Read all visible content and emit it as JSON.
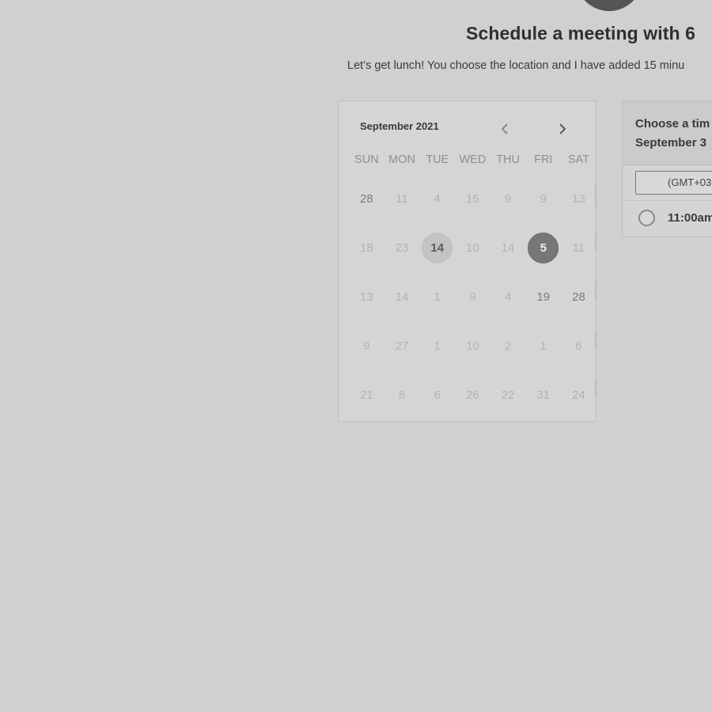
{
  "header": {
    "title": "Schedule a meeting with 6",
    "description": "Let’s get lunch! You choose the location and I have added 15 minu"
  },
  "calendar": {
    "month_label": "September 2021",
    "prev_icon": "chevron-left-icon",
    "next_icon": "chevron-right-icon",
    "weekdays": [
      "SUN",
      "MON",
      "TUE",
      "WED",
      "THU",
      "FRI",
      "SAT"
    ],
    "weeks": [
      [
        "28",
        "11",
        "4",
        "15",
        "9",
        "9",
        "13"
      ],
      [
        "18",
        "23",
        "14",
        "10",
        "14",
        "5",
        "11"
      ],
      [
        "13",
        "14",
        "1",
        "9",
        "4",
        "19",
        "28"
      ],
      [
        "9",
        "27",
        "1",
        "10",
        "2",
        "1",
        "6"
      ],
      [
        "21",
        "8",
        "6",
        "26",
        "22",
        "31",
        "24"
      ]
    ],
    "today": "14",
    "selected": "5"
  },
  "time_panel": {
    "title": "Choose a tim",
    "date": "September 3",
    "timezone": "(GMT+03",
    "slots": [
      {
        "label": "11:00am"
      }
    ]
  },
  "colors": {
    "background": "#d0d0d0",
    "selected_day": "#777777",
    "today_day": "#c3c3c3"
  }
}
